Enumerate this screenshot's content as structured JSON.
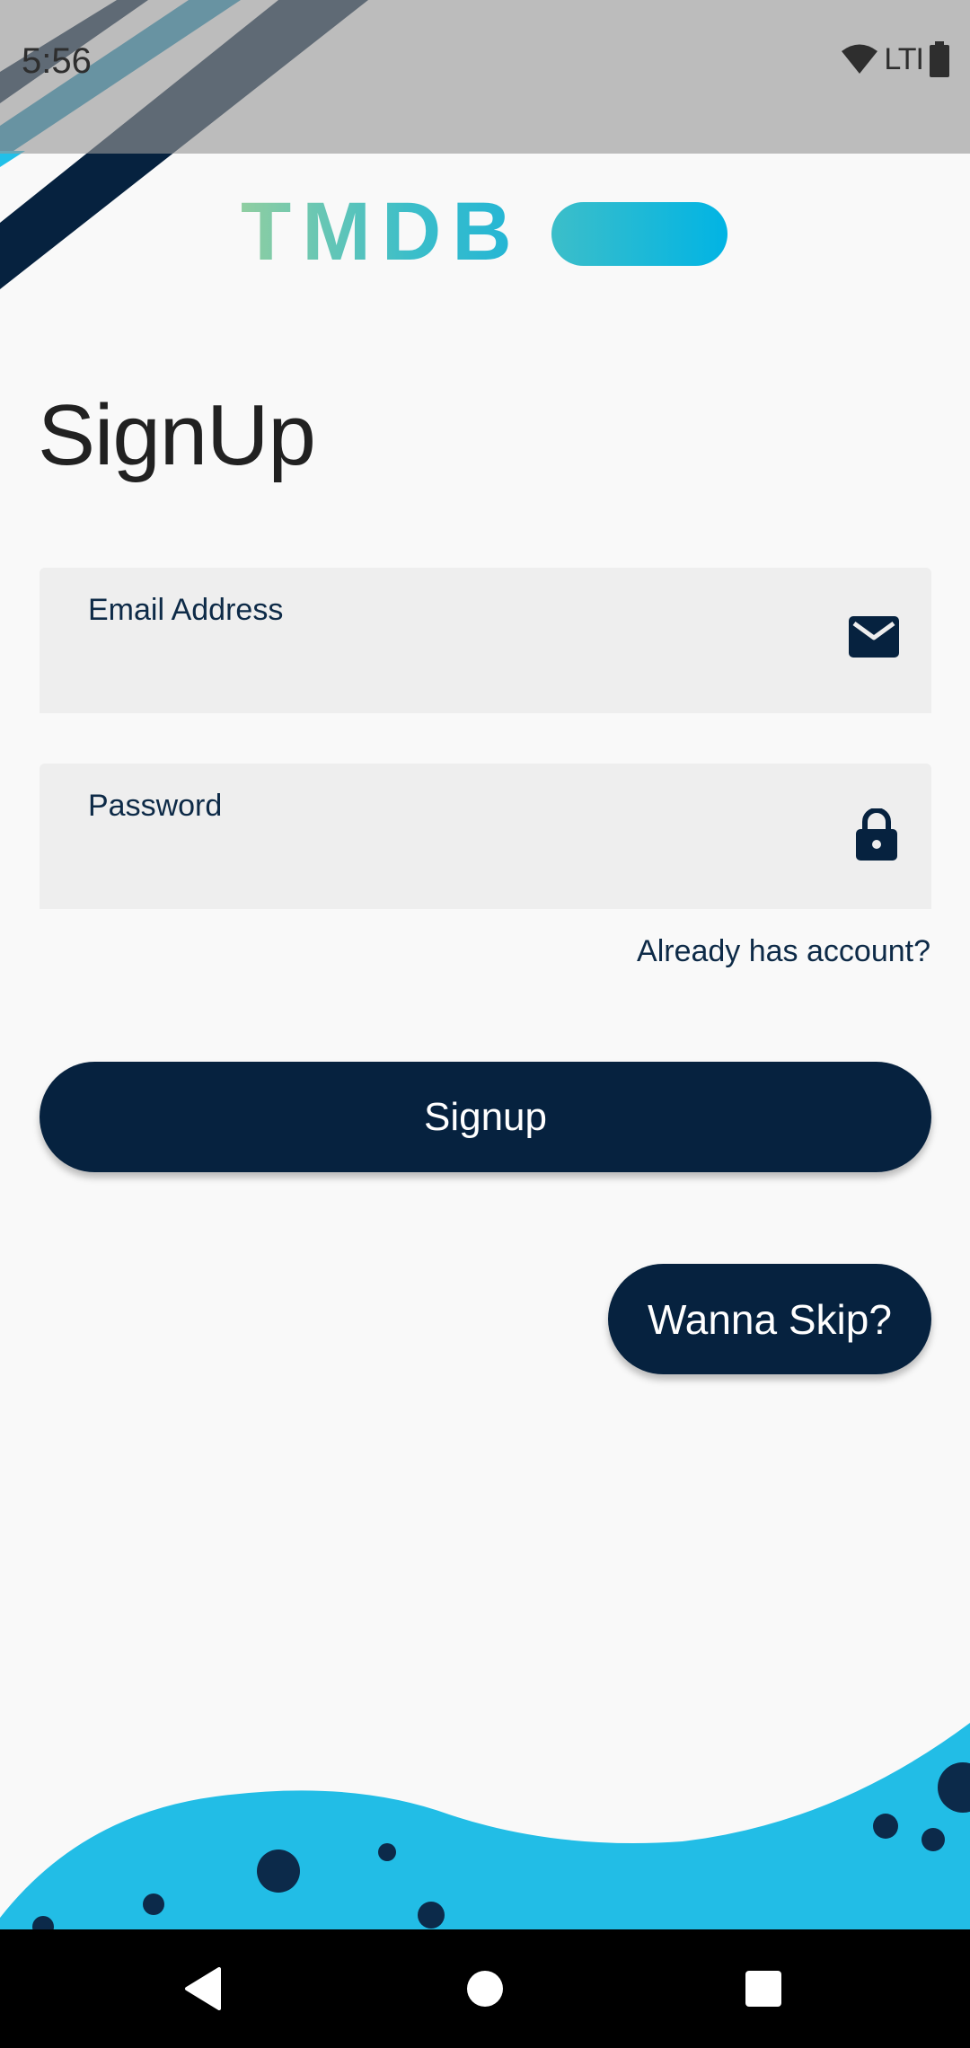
{
  "status_bar": {
    "time": "5:56",
    "network_label": "LTI",
    "icons": [
      "wifi-icon",
      "battery-icon"
    ]
  },
  "logo": {
    "text": "TMDB"
  },
  "page": {
    "title": "SignUp"
  },
  "form": {
    "email": {
      "label": "Email Address",
      "value": "",
      "icon": "email-icon"
    },
    "password": {
      "label": "Password",
      "value": "",
      "icon": "lock-icon"
    },
    "already_account_link": "Already has account?",
    "signup_label": "Signup",
    "skip_label": "Wanna Skip?"
  },
  "nav_bar": {
    "icons": [
      "back-icon",
      "home-icon",
      "recents-icon"
    ]
  },
  "colors": {
    "primary": "#06223f",
    "accent": "#22b5d6",
    "background": "#f9f9f9",
    "field": "#eeeeee"
  }
}
